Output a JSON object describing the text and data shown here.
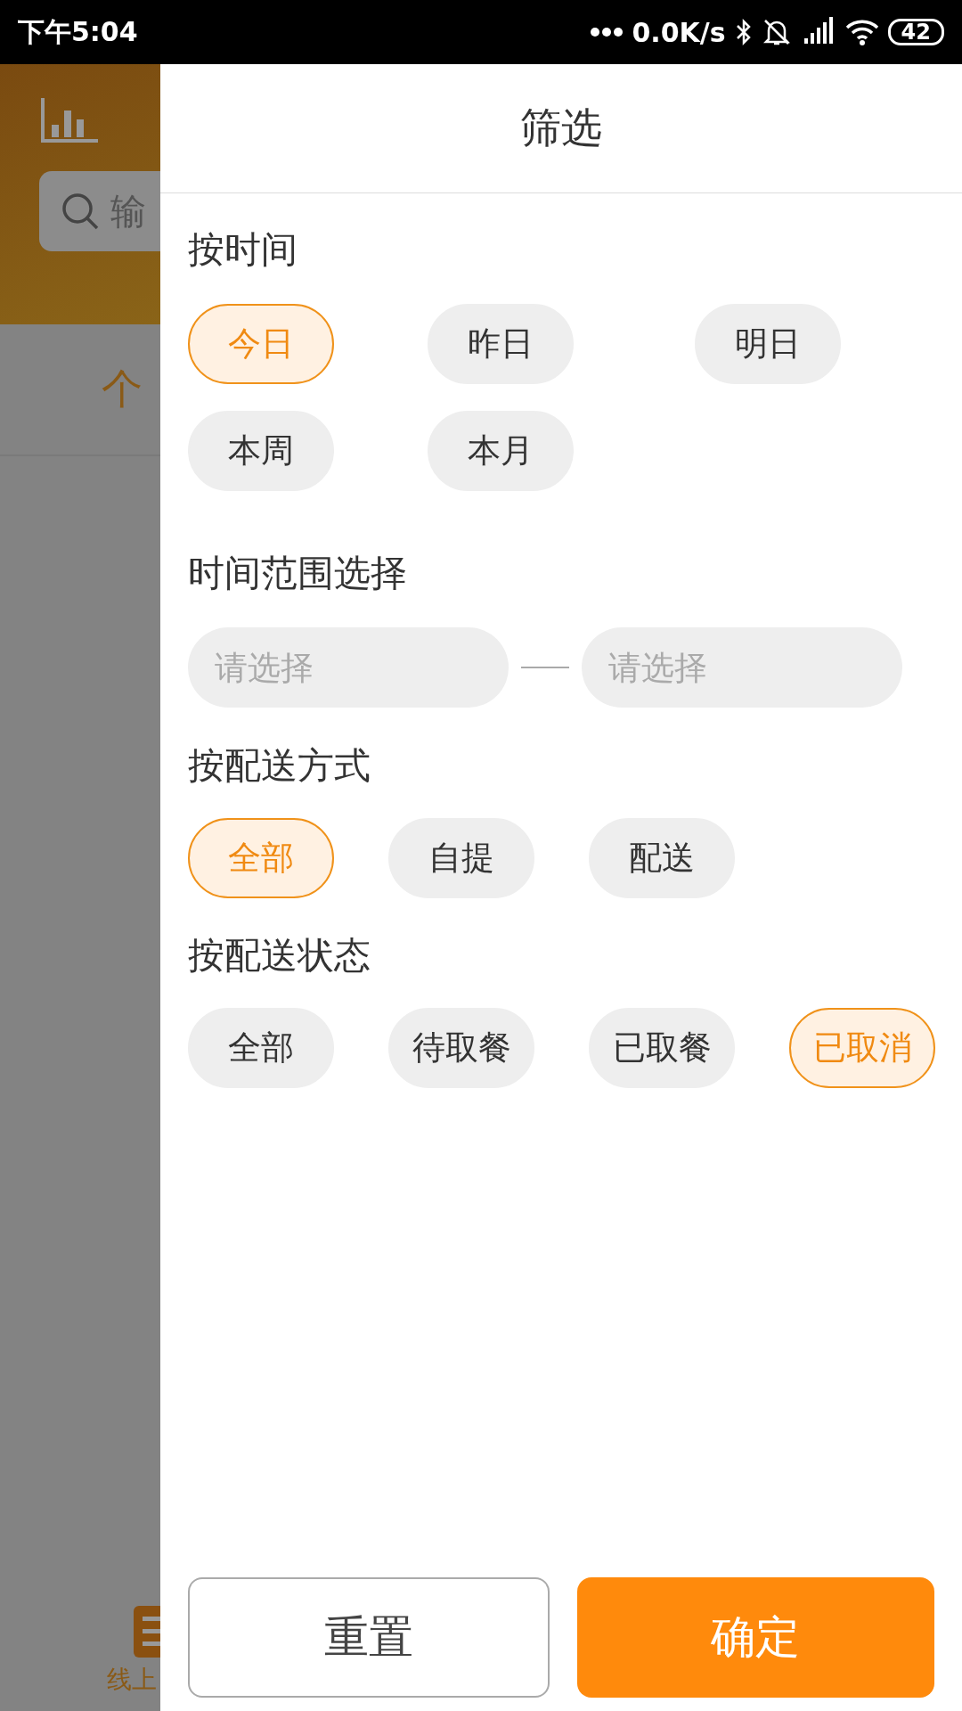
{
  "status_bar": {
    "time": "下午5:04",
    "network_speed": "0.0K/s",
    "battery": "42"
  },
  "background": {
    "search_placeholder": "输",
    "tab_label": "个",
    "nav_label": "线上"
  },
  "filter_panel": {
    "title": "筛选",
    "time_section": {
      "heading": "按时间",
      "options": [
        {
          "label": "今日",
          "selected": true
        },
        {
          "label": "昨日",
          "selected": false
        },
        {
          "label": "明日",
          "selected": false
        },
        {
          "label": "本周",
          "selected": false
        },
        {
          "label": "本月",
          "selected": false
        }
      ]
    },
    "range_section": {
      "heading": "时间范围选择",
      "start_placeholder": "请选择",
      "end_placeholder": "请选择"
    },
    "delivery_method_section": {
      "heading": "按配送方式",
      "options": [
        {
          "label": "全部",
          "selected": true
        },
        {
          "label": "自提",
          "selected": false
        },
        {
          "label": "配送",
          "selected": false
        }
      ]
    },
    "delivery_status_section": {
      "heading": "按配送状态",
      "options": [
        {
          "label": "全部",
          "selected": false
        },
        {
          "label": "待取餐",
          "selected": false
        },
        {
          "label": "已取餐",
          "selected": false
        },
        {
          "label": "已取消",
          "selected": true
        }
      ]
    },
    "buttons": {
      "reset": "重置",
      "confirm": "确定"
    }
  }
}
